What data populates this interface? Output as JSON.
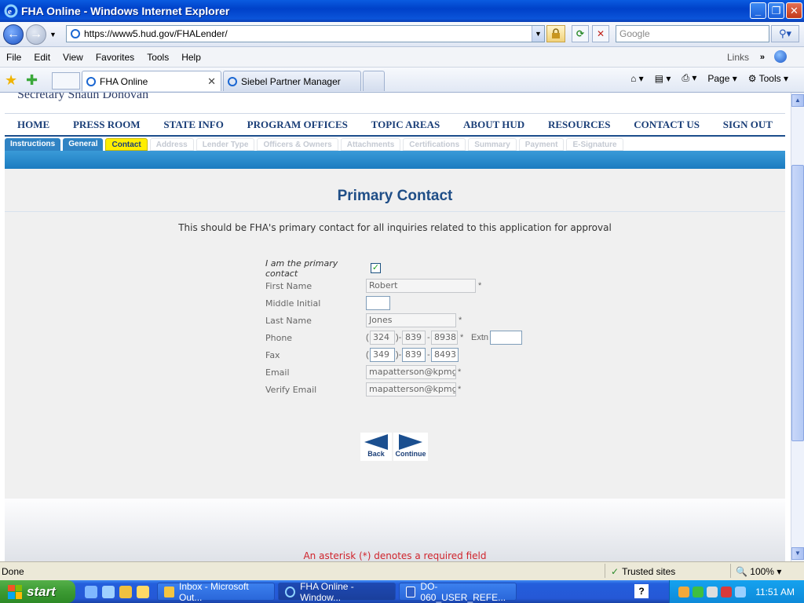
{
  "window": {
    "title": "FHA Online - Windows Internet Explorer"
  },
  "toolbar": {
    "address": "https://www5.hud.gov/FHALender/",
    "search_placeholder": "Google"
  },
  "menu": [
    "File",
    "Edit",
    "View",
    "Favorites",
    "Tools",
    "Help"
  ],
  "menu_right": {
    "links": "Links",
    "links_arrow": "»"
  },
  "tabs": [
    {
      "label": "FHA Online"
    },
    {
      "label": "Siebel Partner Manager"
    }
  ],
  "command_bar": {
    "page": "Page",
    "tools": "Tools"
  },
  "page": {
    "secretary": "Secretary Shaun Donovan",
    "nav": [
      "HOME",
      "PRESS ROOM",
      "STATE INFO",
      "PROGRAM OFFICES",
      "TOPIC AREAS",
      "ABOUT HUD",
      "RESOURCES",
      "CONTACT US",
      "SIGN OUT"
    ],
    "steps": [
      {
        "label": "Instructions",
        "state": "done"
      },
      {
        "label": "General",
        "state": "done"
      },
      {
        "label": "Contact",
        "state": "current"
      },
      {
        "label": "Address",
        "state": "disabled"
      },
      {
        "label": "Lender Type",
        "state": "disabled"
      },
      {
        "label": "Officers & Owners",
        "state": "disabled"
      },
      {
        "label": "Attachments",
        "state": "disabled"
      },
      {
        "label": "Certifications",
        "state": "disabled"
      },
      {
        "label": "Summary",
        "state": "disabled"
      },
      {
        "label": "Payment",
        "state": "disabled"
      },
      {
        "label": "E-Signature",
        "state": "disabled"
      }
    ],
    "heading": "Primary Contact",
    "lead": "This should be FHA's primary contact for all inquiries related to this application for approval",
    "form": {
      "primary_label": "I am the primary contact",
      "primary_checked": true,
      "first_name_label": "First Name",
      "first_name": "Robert",
      "middle_initial_label": "Middle Initial",
      "middle_initial": "",
      "last_name_label": "Last Name",
      "last_name": "Jones",
      "phone_label": "Phone",
      "phone": {
        "area": "324",
        "prefix": "839",
        "line": "8938"
      },
      "extn_label": "Extn",
      "extn": "",
      "fax_label": "Fax",
      "fax": {
        "area": "349",
        "prefix": "839",
        "line": "8493"
      },
      "email_label": "Email",
      "email": "mapatterson@kpmg",
      "verify_email_label": "Verify Email",
      "verify_email": "mapatterson@kpmg",
      "required_mark": "*",
      "open_paren": "(",
      "close_paren": ")",
      "dash": "-"
    },
    "buttons": {
      "back": "Back",
      "continue": "Continue"
    },
    "footer_note": "An asterisk (*) denotes a required field"
  },
  "status": {
    "text": "Done",
    "zone": "Trusted sites",
    "zoom": "100%"
  },
  "taskbar": {
    "start": "start",
    "items": [
      {
        "label": "Inbox - Microsoft Out..."
      },
      {
        "label": "FHA Online - Window..."
      },
      {
        "label": "DO-060_USER_REFE..."
      }
    ],
    "clock": "11:51 AM"
  },
  "colors": {
    "nav_text": "#1b3f78",
    "heading": "#1f4e87",
    "required_note": "#d0242c",
    "current_step": "#ffee00"
  }
}
